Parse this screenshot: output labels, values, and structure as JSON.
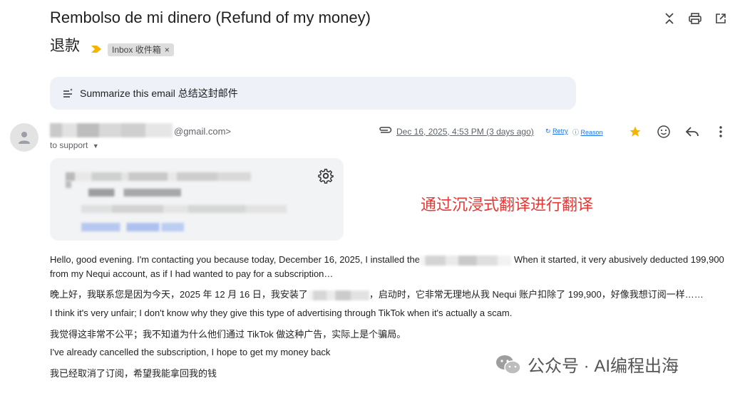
{
  "email": {
    "subject": "Rembolso de mi dinero (Refund of my money)",
    "subject_translated": "退款",
    "label_chip": "Inbox 收件箱",
    "label_remove": "×"
  },
  "summarize": {
    "label": "Summarize this email 总结这封邮件"
  },
  "sender": {
    "email_domain": "@gmail.com>",
    "to_line": "to support",
    "date": "Dec 16, 2025, 4:53 PM (3 days ago)",
    "retry": "Retry",
    "reason": "Reason"
  },
  "annotation": {
    "translation_note": "通过沉浸式翻译进行翻译"
  },
  "body": {
    "p1_line1_a": "Hello, good evening. I'm contacting you because today, December 16, 2025, I installed the",
    "p1_line1_b": "When it started, it very abusively deducted 199,900",
    "p1_line2": "from my Nequi account, as if I had wanted to pay for a subscription…",
    "p1_zh_a": "晚上好，我联系您是因为今天，2025 年 12 月 16 日，我安装了",
    "p1_zh_b": "，启动时，它非常无理地从我 Nequi 账户扣除了 199,900，好像我想订阅一样……",
    "p2": "I think it's very unfair; I don't know why they give this type of advertising through TikTok when it's actually a scam.",
    "p2_zh": "我觉得这非常不公平；我不知道为什么他们通过 TikTok 做这种广告，实际上是个骗局。",
    "p3": "I've already cancelled the subscription, I hope to get my money back",
    "p3_zh": "我已经取消了订阅，希望我能拿回我的钱"
  },
  "watermark": {
    "text": "公众号 · AI编程出海"
  },
  "colors": {
    "accent_blue": "#1a73e8",
    "annotation_red": "#e53935",
    "label_yellow": "#f4b400",
    "star_yellow": "#f4b400"
  },
  "icons": {
    "top_bar": [
      "collapse-icon",
      "print-icon",
      "open-in-new-icon"
    ],
    "row": [
      "star-icon",
      "emoji-icon",
      "reply-icon",
      "more-vert-icon"
    ]
  }
}
